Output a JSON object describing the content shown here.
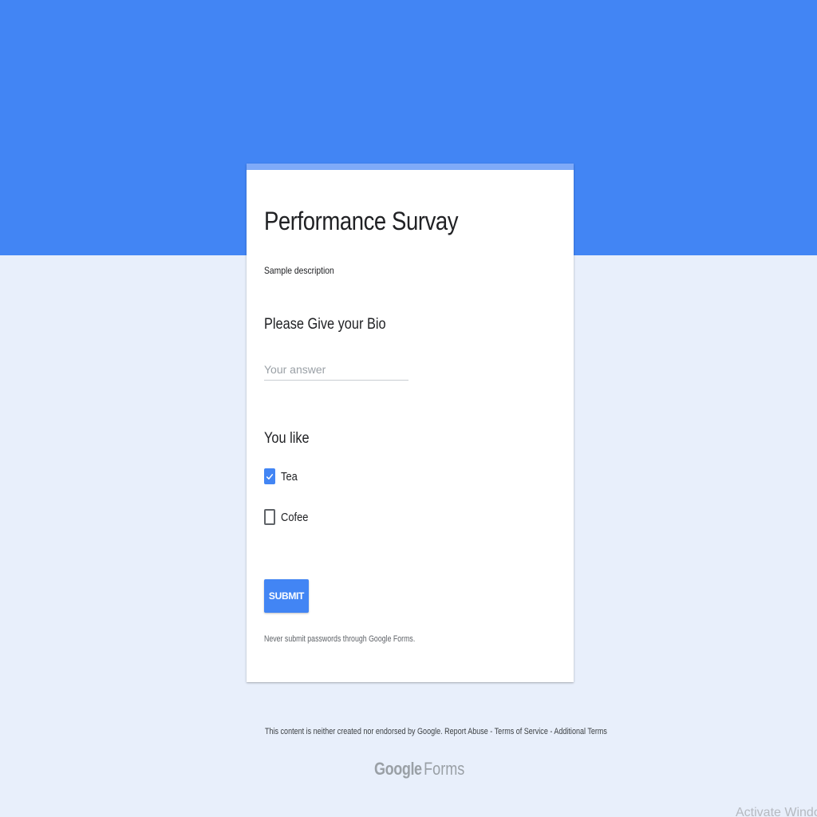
{
  "form": {
    "title": "Performance Survay",
    "description": "Sample description",
    "questions": [
      {
        "title": "Please Give your Bio",
        "type": "short-answer",
        "placeholder": "Your answer",
        "value": ""
      },
      {
        "title": "You like",
        "type": "checkbox",
        "options": [
          {
            "label": "Tea",
            "checked": true
          },
          {
            "label": "Cofee",
            "checked": false
          }
        ]
      }
    ],
    "submit_label": "SUBMIT",
    "password_warning": "Never submit passwords through Google Forms."
  },
  "footer": {
    "disclaimer": "This content is neither created nor endorsed by Google.",
    "report_abuse": "Report Abuse",
    "separator": "-",
    "terms_of_service": "Terms of Service",
    "additional_terms": "Additional Terms",
    "brand_google": "Google",
    "brand_forms": "Forms"
  },
  "watermark": "Activate Windows",
  "colors": {
    "header": "#4285f4",
    "background": "#e8effb",
    "accent": "#4285f4",
    "card_top_accent": "#7faaf8"
  },
  "icons": {
    "checkmark": "check-icon"
  }
}
